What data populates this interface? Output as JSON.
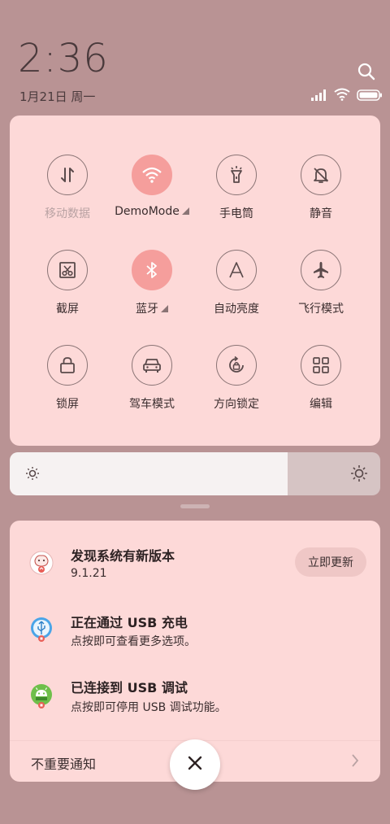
{
  "status": {
    "time": "2:36",
    "date": "1月21日 周一"
  },
  "quick_settings": {
    "tiles": [
      {
        "label": "移动数据",
        "icon": "mobile-data-icon",
        "active": false,
        "disabled": true
      },
      {
        "label": "DemoMode",
        "icon": "wifi-icon",
        "active": true,
        "expand": true
      },
      {
        "label": "手电筒",
        "icon": "flashlight-icon",
        "active": false
      },
      {
        "label": "静音",
        "icon": "bell-off-icon",
        "active": false
      },
      {
        "label": "截屏",
        "icon": "screenshot-icon",
        "active": false
      },
      {
        "label": "蓝牙",
        "icon": "bluetooth-icon",
        "active": true,
        "expand": true
      },
      {
        "label": "自动亮度",
        "icon": "auto-brightness-icon",
        "active": false
      },
      {
        "label": "飞行模式",
        "icon": "airplane-icon",
        "active": false
      },
      {
        "label": "锁屏",
        "icon": "lock-icon",
        "active": false
      },
      {
        "label": "驾车模式",
        "icon": "car-icon",
        "active": false
      },
      {
        "label": "方向锁定",
        "icon": "rotation-lock-icon",
        "active": false
      },
      {
        "label": "编辑",
        "icon": "grid-icon",
        "active": false
      }
    ]
  },
  "brightness": {
    "level": 0.75
  },
  "notifications": [
    {
      "title": "发现系统有新版本",
      "body": "9.1.21",
      "action": "立即更新",
      "icon": "updater-app-icon"
    },
    {
      "title": "正在通过 USB 充电",
      "body": "点按即可查看更多选项。",
      "icon": "usb-app-icon"
    },
    {
      "title": "已连接到 USB 调试",
      "body": "点按即可停用 USB 调试功能。",
      "icon": "android-app-icon"
    }
  ],
  "minor_notifications_label": "不重要通知",
  "colors": {
    "background": "#b99394",
    "panel": "#fdd9d8",
    "accent": "#f59e9c"
  }
}
